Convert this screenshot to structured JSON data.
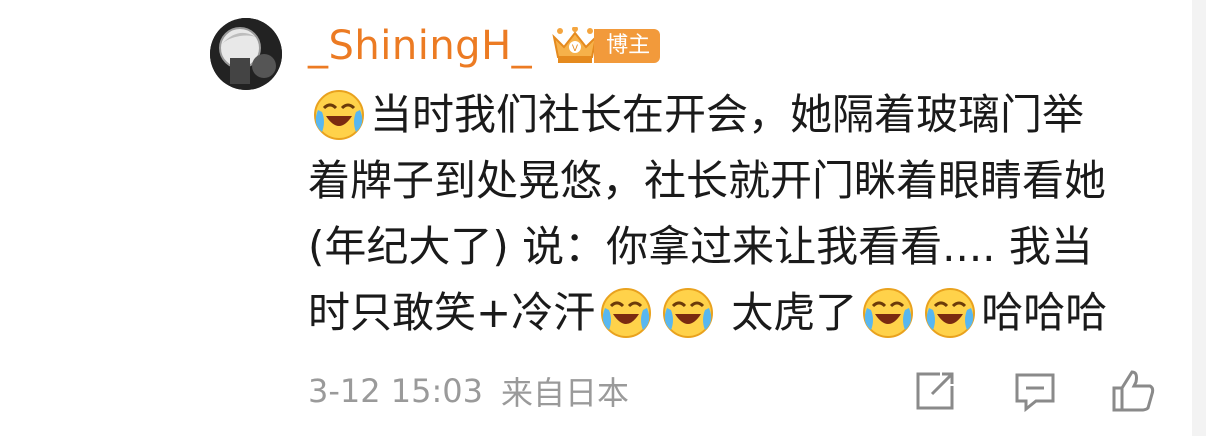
{
  "comment": {
    "username": "_ShiningH_",
    "badge_label": "博主",
    "lines": [
      {
        "pre_emoji": true,
        "text": "当时我们社长在开会，她隔着玻璃门举"
      },
      {
        "text": "着牌子到处晃悠，社长就开门眯着眼睛看她"
      },
      {
        "text": "(年纪大了) 说：你拿过来让我看看.... 我当"
      }
    ],
    "last_line": {
      "seg1": "时只敢笑+冷汗",
      "seg2": "太虎了",
      "seg3": "哈哈哈"
    },
    "emoji_name": "laugh-cry-emoji",
    "timestamp": "3-12 15:03",
    "source": "来自日本"
  },
  "actions": [
    "share-icon",
    "comment-icon",
    "like-icon"
  ],
  "colors": {
    "username": "#ec7b23",
    "badge": "#f29a3b",
    "meta": "#9a9a9a",
    "text": "#1a1a1a",
    "icon": "#8a8a8a"
  }
}
